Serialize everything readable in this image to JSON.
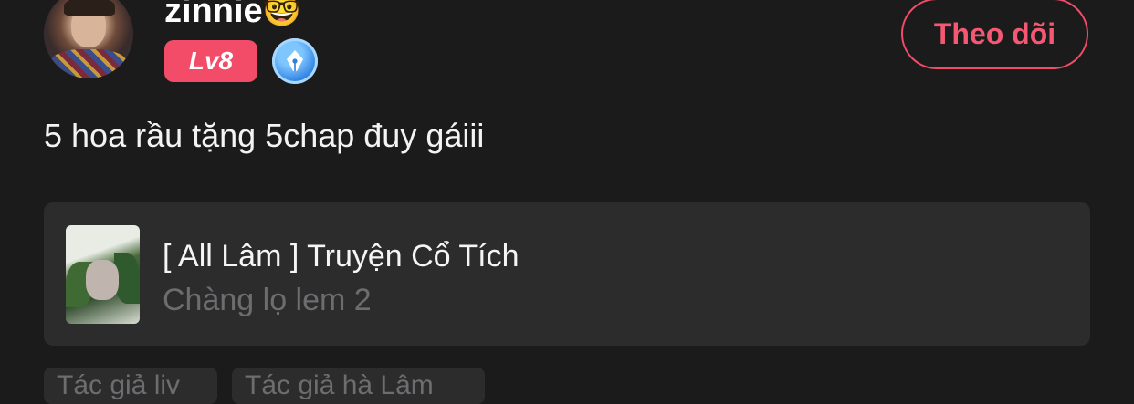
{
  "user": {
    "name": "zinnie",
    "name_emoji": "🤓",
    "level": "Lv8",
    "badge_icon": "pen-nib-icon"
  },
  "follow_button": {
    "label": "Theo dõi"
  },
  "post": {
    "text": "5 hoa rầu tặng 5chap đuy gáiii"
  },
  "story": {
    "title": "[ All Lâm ] Truyện Cổ Tích",
    "chapter": "Chàng lọ lem 2"
  },
  "tags": [
    "Tác giả liv",
    "Tác giả hà Lâm"
  ],
  "colors": {
    "background": "#1b1b1c",
    "card": "#2c2c2d",
    "accent": "#f24c68",
    "muted_text": "#6d6d70"
  }
}
